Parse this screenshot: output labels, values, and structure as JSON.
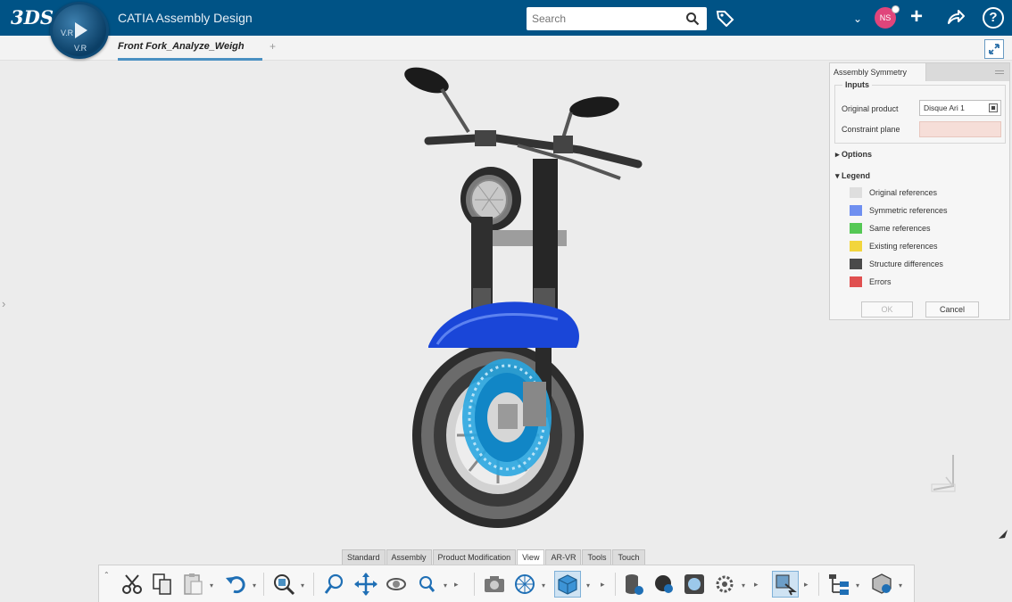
{
  "app": {
    "title": "CATIA Assembly Design",
    "brand_logo": "3DS",
    "compass_label_left": "V.R",
    "compass_label_bottom": "V.R"
  },
  "header": {
    "search_placeholder": "Search",
    "avatar_initials": "NS",
    "icons": [
      "search-icon",
      "tag-icon",
      "chevron-down-icon",
      "plus-icon",
      "share-icon",
      "help-icon"
    ]
  },
  "document": {
    "tab_label": "Front Fork_Analyze_Weigh",
    "add_tab": "+"
  },
  "panel": {
    "title": "Assembly Symmetry",
    "inputs_title": "Inputs",
    "original_product_label": "Original product",
    "original_product_value": "Disque Ari 1",
    "constraint_plane_label": "Constraint plane",
    "constraint_plane_value": "",
    "options_label": "Options",
    "legend_label": "Legend",
    "legend": [
      {
        "label": "Original references",
        "color": "#dedede"
      },
      {
        "label": "Symmetric references",
        "color": "#6f8ff0"
      },
      {
        "label": "Same references",
        "color": "#55c855"
      },
      {
        "label": "Existing references",
        "color": "#f2d53c"
      },
      {
        "label": "Structure differences",
        "color": "#4a4a4a"
      },
      {
        "label": "Errors",
        "color": "#e05050"
      }
    ],
    "ok_label": "OK",
    "cancel_label": "Cancel"
  },
  "toolbar": {
    "section_tabs": [
      "Standard",
      "Assembly",
      "Product Modification",
      "View",
      "AR-VR",
      "Tools",
      "Touch"
    ],
    "active_tab": "View"
  },
  "colors": {
    "header": "#005386",
    "accent": "#4a90c2",
    "fender": "#1a46d8",
    "brake_disc": "#2aa6e0"
  }
}
